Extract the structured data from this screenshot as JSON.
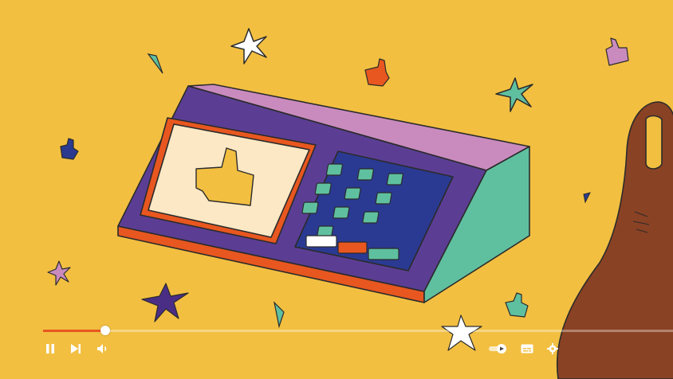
{
  "player": {
    "progress_fraction": 0.099,
    "colors": {
      "background": "#F2BF41",
      "progress_fill": "#E8571F",
      "device_purple": "#5B3E94",
      "device_top": "#C98BBE",
      "device_side": "#5FC0A0",
      "screen": "#FCE8C4",
      "finger": "#8A4224"
    },
    "controls": {
      "left": [
        "pause-icon",
        "next-icon",
        "volume-icon"
      ],
      "right": [
        "autoplay-toggle-icon",
        "subtitles-icon",
        "settings-icon"
      ]
    }
  }
}
